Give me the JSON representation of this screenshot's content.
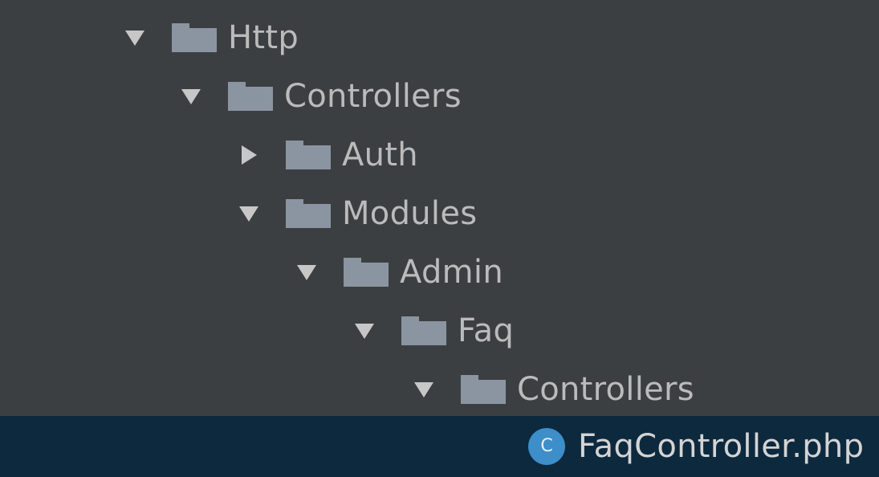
{
  "project_tree": {
    "nodes": [
      {
        "label": "Http",
        "expanded": true,
        "icon": "folder-icon"
      },
      {
        "label": "Controllers",
        "expanded": true,
        "icon": "folder-icon"
      },
      {
        "label": "Auth",
        "expanded": false,
        "icon": "folder-icon"
      },
      {
        "label": "Modules",
        "expanded": true,
        "icon": "folder-icon"
      },
      {
        "label": "Admin",
        "expanded": true,
        "icon": "folder-icon"
      },
      {
        "label": "Faq",
        "expanded": true,
        "icon": "folder-icon"
      },
      {
        "label": "Controllers",
        "expanded": true,
        "icon": "folder-icon"
      },
      {
        "label": "FaqController.php",
        "selected": true,
        "icon": "php-class-icon",
        "icon_letter": "C"
      }
    ]
  },
  "colors": {
    "background": "#3c3f41",
    "selection": "#0d293e",
    "folder": "#8b95a1",
    "text": "#bbbbbb",
    "class_icon": "#3d8ec9"
  }
}
